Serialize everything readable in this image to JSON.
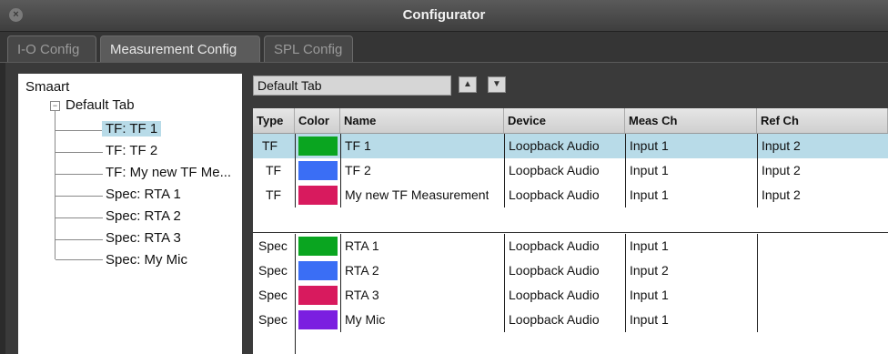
{
  "window": {
    "title": "Configurator"
  },
  "tabs": [
    {
      "label": "I-O Config",
      "active": false
    },
    {
      "label": "Measurement Config",
      "active": true
    },
    {
      "label": "SPL Config",
      "active": false
    }
  ],
  "tree": {
    "root": "Smaart",
    "group": "Default Tab",
    "items": [
      "TF: TF 1",
      "TF: TF 2",
      "TF: My new TF Me...",
      "Spec: RTA 1",
      "Spec: RTA 2",
      "Spec: RTA 3",
      "Spec: My Mic"
    ],
    "selected_index": 0
  },
  "tab_name_field": {
    "value": "Default Tab"
  },
  "table": {
    "headers": [
      "Type",
      "Color",
      "Name",
      "Device",
      "Meas Ch",
      "Ref Ch"
    ],
    "tf_rows": [
      {
        "type": "TF",
        "color": "#0aa520",
        "name": "TF 1",
        "device": "Loopback Audio",
        "meas": "Input 1",
        "ref": "Input 2"
      },
      {
        "type": "TF",
        "color": "#3a6ef5",
        "name": "TF 2",
        "device": "Loopback Audio",
        "meas": "Input 1",
        "ref": "Input 2"
      },
      {
        "type": "TF",
        "color": "#d81a5e",
        "name": "My new TF Measurement",
        "device": "Loopback Audio",
        "meas": "Input 1",
        "ref": "Input 2"
      }
    ],
    "spec_rows": [
      {
        "type": "Spec",
        "color": "#0aa520",
        "name": "RTA 1",
        "device": "Loopback Audio",
        "meas": "Input 1",
        "ref": ""
      },
      {
        "type": "Spec",
        "color": "#3a6ef5",
        "name": "RTA 2",
        "device": "Loopback Audio",
        "meas": "Input 2",
        "ref": ""
      },
      {
        "type": "Spec",
        "color": "#d81a5e",
        "name": "RTA 3",
        "device": "Loopback Audio",
        "meas": "Input 1",
        "ref": ""
      },
      {
        "type": "Spec",
        "color": "#7b1fe0",
        "name": "My Mic",
        "device": "Loopback Audio",
        "meas": "Input 1",
        "ref": ""
      }
    ]
  },
  "colors": {
    "selection": "#b8dbe8"
  }
}
